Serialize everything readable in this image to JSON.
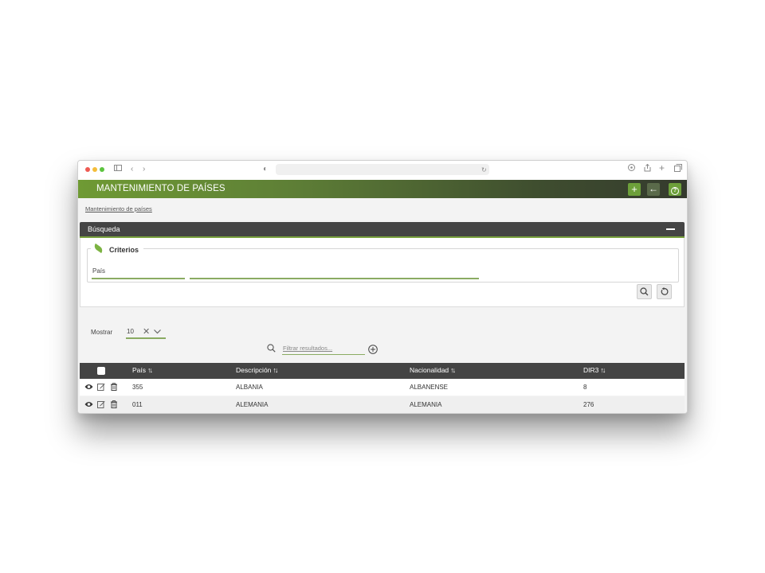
{
  "browser": {
    "traffic_lights": [
      "#ee5a52",
      "#f4bd3a",
      "#5cc43f"
    ]
  },
  "app": {
    "title": "MANTENIMIENTO DE PAÍSES",
    "header_buttons": [
      "plus-icon",
      "arrow-left-icon",
      "help-icon"
    ],
    "accent_color": "#6da03a"
  },
  "breadcrumb": "Mantenimiento de países",
  "search_panel": {
    "title": "Búsqueda",
    "criteria_title": "Criterios",
    "field_label": "País",
    "field_code_value": "",
    "field_desc_value": ""
  },
  "list": {
    "show_label": "Mostrar",
    "page_size": "10",
    "filter_placeholder": "Filtrar resultados..."
  },
  "table": {
    "columns": [
      "País",
      "Descripción",
      "Nacionalidad",
      "DIR3"
    ],
    "rows": [
      {
        "pais": "355",
        "descripcion": "ALBANIA",
        "nacionalidad": "ALBANENSE",
        "dir3": "8"
      },
      {
        "pais": "011",
        "descripcion": "ALEMANIA",
        "nacionalidad": "ALEMANIA",
        "dir3": "276"
      }
    ]
  }
}
